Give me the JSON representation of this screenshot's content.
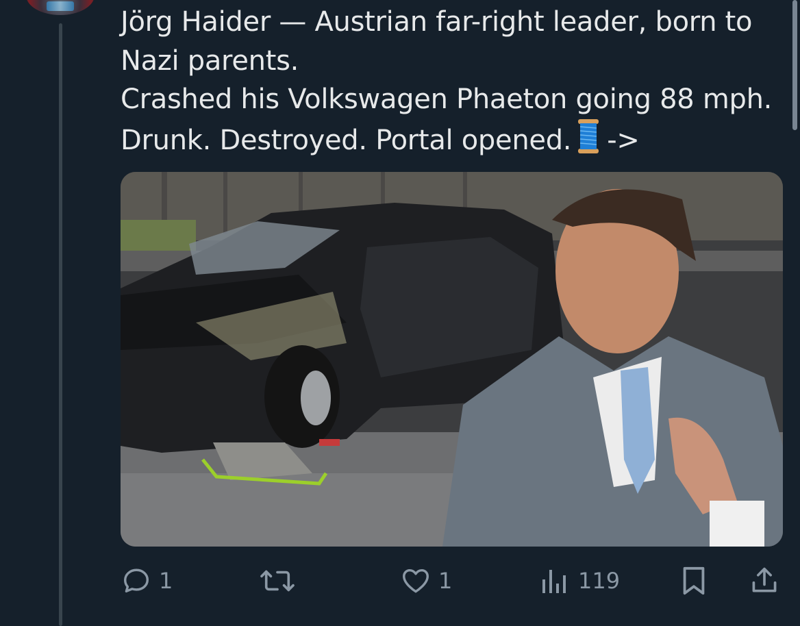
{
  "tweet": {
    "lines": [
      "Jörg Haider — Austrian far-right leader, born to",
      "Nazi parents.",
      "Crashed his Volkswagen Phaeton going 88 mph.",
      "Drunk. Destroyed. Portal opened."
    ],
    "arrow": "->",
    "emoji_icon": "thread-spool-icon"
  },
  "media": {
    "description_icon": "photo"
  },
  "actions": {
    "replies": "1",
    "retweets": "",
    "likes": "1",
    "views": "119"
  },
  "colors": {
    "background": "#15202b",
    "text": "#e7e9ea",
    "muted": "#8b98a5",
    "line": "#38444d"
  }
}
